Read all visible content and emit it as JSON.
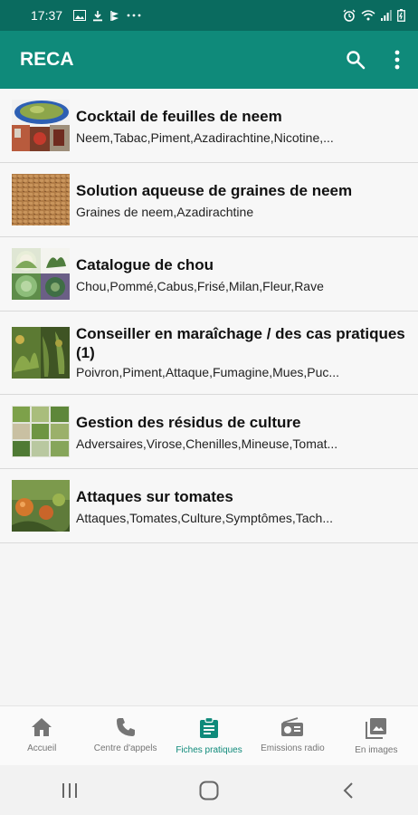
{
  "status_bar": {
    "time": "17:37",
    "left_icons": [
      "image-icon",
      "download-icon",
      "flag-icon",
      "more-dots-icon"
    ],
    "right_icons": [
      "alarm-icon",
      "wifi-icon",
      "signal-icon",
      "battery-icon"
    ]
  },
  "app_bar": {
    "title": "RECA",
    "search_icon": "search-icon",
    "menu_icon": "more-vert-icon"
  },
  "items": [
    {
      "title": "Cocktail de feuilles de neem",
      "subtitle": "Neem,Tabac,Piment,Azadirachtine,Nicotine,..."
    },
    {
      "title": "Solution aqueuse de graines de neem",
      "subtitle": "Graines de neem,Azadirachtine"
    },
    {
      "title": "Catalogue de chou",
      "subtitle": "Chou,Pommé,Cabus,Frisé,Milan,Fleur,Rave"
    },
    {
      "title": "Conseiller en maraîchage / des cas pratiques (1)",
      "subtitle": "Poivron,Piment,Attaque,Fumagine,Mues,Puc..."
    },
    {
      "title": "Gestion des résidus de culture",
      "subtitle": "Adversaires,Virose,Chenilles,Mineuse,Tomat..."
    },
    {
      "title": "Attaques sur tomates",
      "subtitle": "Attaques,Tomates,Culture,Symptômes,Tach..."
    }
  ],
  "bottom_nav": [
    {
      "label": "Accueil",
      "icon": "home-icon"
    },
    {
      "label": "Centre d'appels",
      "icon": "phone-icon"
    },
    {
      "label": "Fiches pratiques",
      "icon": "clipboard-icon",
      "active": true
    },
    {
      "label": "Emissions radio",
      "icon": "radio-icon"
    },
    {
      "label": "En images",
      "icon": "photo-library-icon"
    }
  ],
  "colors": {
    "status_bar": "#0a6b5f",
    "app_bar": "#0f8a7a",
    "accent": "#0f8a7a",
    "nav_inactive": "#757575"
  }
}
